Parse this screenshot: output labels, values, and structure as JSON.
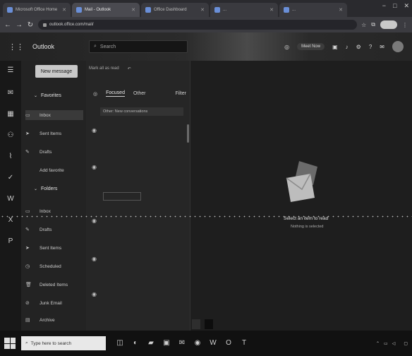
{
  "browser": {
    "tabs": [
      {
        "label": "Microsoft Office Home",
        "active": false
      },
      {
        "label": "Mail - Outlook",
        "active": true
      },
      {
        "label": "Office Dashboard",
        "active": false
      },
      {
        "label": "...",
        "active": false
      },
      {
        "label": "...",
        "active": false
      }
    ],
    "url": "outlook.office.com/mail/",
    "win_controls": [
      "−",
      "□",
      "✕"
    ]
  },
  "outlook": {
    "brand": "Outlook",
    "search_placeholder": "Search",
    "meet_now": "Meet Now"
  },
  "folders": {
    "new_message": "New message",
    "favorites_header": "Favorites",
    "folders_header": "Folders",
    "favorites": [
      {
        "icon": "inbox-icon",
        "label": "Inbox",
        "count": "",
        "selected": true
      },
      {
        "icon": "send-icon",
        "label": "Sent Items",
        "count": ""
      },
      {
        "icon": "pencil-icon",
        "label": "Drafts",
        "count": ""
      },
      {
        "icon": "none",
        "label": "Add favorite",
        "count": ""
      }
    ],
    "items": [
      {
        "icon": "inbox-icon",
        "label": "Inbox",
        "count": ""
      },
      {
        "icon": "pencil-icon",
        "label": "Drafts",
        "count": ""
      },
      {
        "icon": "send-icon",
        "label": "Sent Items",
        "count": ""
      },
      {
        "icon": "clock-icon",
        "label": "Scheduled",
        "count": ""
      },
      {
        "icon": "trash-icon",
        "label": "Deleted Items",
        "count": ""
      },
      {
        "icon": "ban-icon",
        "label": "Junk Email",
        "count": ""
      },
      {
        "icon": "archive-icon",
        "label": "Archive",
        "count": ""
      }
    ]
  },
  "list": {
    "mark_all_read": "Mark all as read",
    "tab_focused": "Focused",
    "tab_other": "Other",
    "filter": "Filter",
    "notice": "Other: New conversations",
    "messages": [
      {
        "from": "",
        "subject": "",
        "preview": "",
        "time": "",
        "count": ""
      },
      {
        "from": "",
        "subject": "",
        "preview": "",
        "time": "",
        "count": ""
      },
      {
        "from": "",
        "subject": "",
        "preview": "",
        "time": "",
        "count": ""
      },
      {
        "from": "",
        "subject": "",
        "preview": "",
        "time": "",
        "count": ""
      },
      {
        "from": "",
        "subject": "",
        "preview": "",
        "time": "",
        "count": ""
      }
    ],
    "attachment": ""
  },
  "reading": {
    "top_label": "",
    "top_sub": "",
    "empty_title": "Select an item to read",
    "empty_sub": "Nothing is selected"
  },
  "bottom": {
    "btn1": "",
    "btn2": ""
  },
  "taskbar": {
    "search_placeholder": "Type here to search",
    "time": "",
    "date": ""
  },
  "colors": {
    "bg": "#1b1b1b",
    "pane": "#232323",
    "list": "#262626",
    "accent": "#c8c8c8"
  }
}
